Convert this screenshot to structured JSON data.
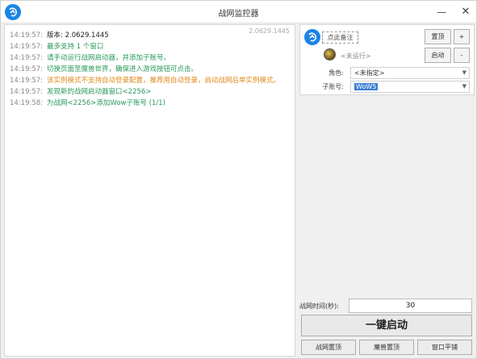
{
  "window": {
    "title": "战网监控器",
    "min_icon": "—",
    "close_icon": "✕"
  },
  "log": {
    "version": "2.0629.1445",
    "lines": [
      {
        "time": "14:19:57:",
        "text": "版本: 2.0629.1445",
        "color": "#222222"
      },
      {
        "time": "14:19:57:",
        "text": "最多支持 1 个窗口",
        "color": "#2a9a5a"
      },
      {
        "time": "14:19:57:",
        "text": "请手动运行战网启动器，并添加子账号。",
        "color": "#2a9a5a"
      },
      {
        "time": "14:19:57:",
        "text": "切换页面至魔兽世界，确保进入游戏按钮可点击。",
        "color": "#2a9a5a"
      },
      {
        "time": "14:19:57:",
        "text": "该实例模式不支持自动登录配置，推荐用自动登录，启动战网后单实例模式。",
        "color": "#e08a1a"
      },
      {
        "time": "14:19:57:",
        "text": "发现新的战网启动器窗口<2256>",
        "color": "#2a9a5a"
      },
      {
        "time": "14:19:58:",
        "text": "为战网<2256>添加Wow子账号 (1/1)",
        "color": "#2a9a5a"
      }
    ]
  },
  "account": {
    "note_label": "点此备注",
    "top_button": "置顶",
    "plus_button": "+",
    "status": "<未运行>",
    "start_button": "启动",
    "minus_button": "-",
    "role_label": "角色:",
    "role_value": "<未指定>",
    "sub_label": "子账号:",
    "sub_value": "WoW5"
  },
  "footer": {
    "time_label": "战网时间(秒):",
    "time_value": "30",
    "start_all": "一键启动",
    "btn_bnet_top": "战网置顶",
    "btn_wow_top": "魔兽置顶",
    "btn_tile": "窗口平铺"
  }
}
